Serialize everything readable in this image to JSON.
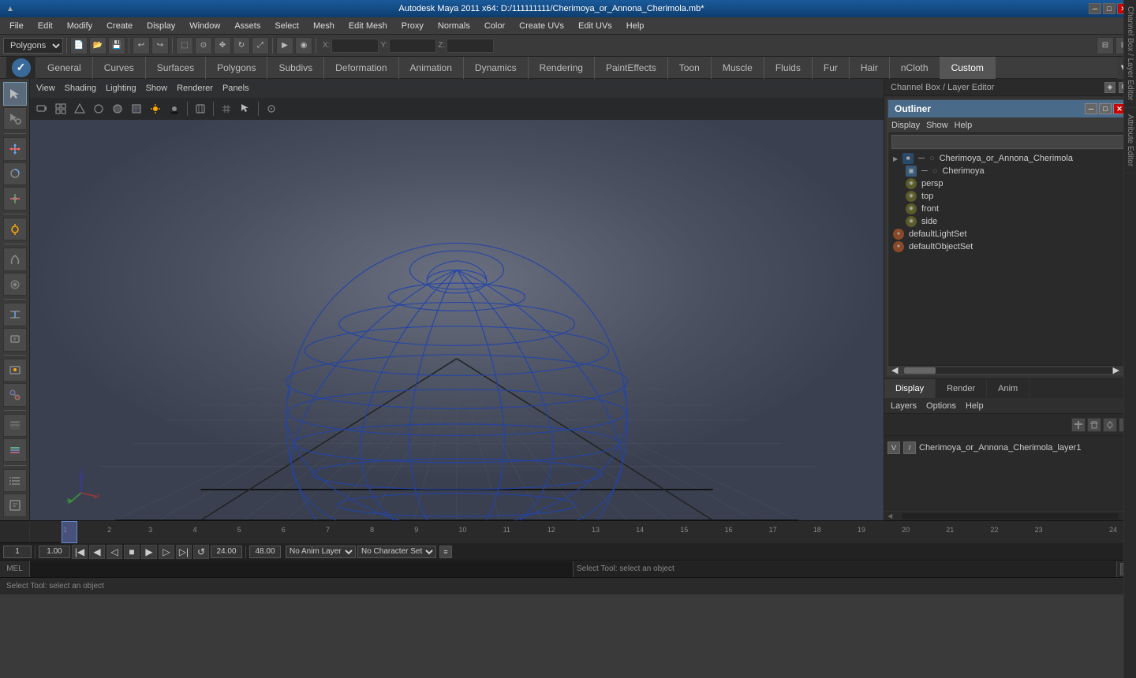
{
  "titleBar": {
    "title": "Autodesk Maya 2011 x64: D:/111111111/Cherimoya_or_Annona_Cherimola.mb*",
    "minBtn": "─",
    "maxBtn": "□",
    "closeBtn": "✕"
  },
  "menuBar": {
    "items": [
      "File",
      "Edit",
      "Modify",
      "Create",
      "Display",
      "Window",
      "Assets",
      "Select",
      "Mesh",
      "Edit Mesh",
      "Proxy",
      "Normals",
      "Color",
      "Create UVs",
      "Edit UVs",
      "Help"
    ]
  },
  "moduleTabs": {
    "items": [
      "General",
      "Curves",
      "Surfaces",
      "Polygons",
      "Subdivs",
      "Deformation",
      "Animation",
      "Dynamics",
      "Rendering",
      "PaintEffects",
      "Toon",
      "Muscle",
      "Fluids",
      "Fur",
      "Hair",
      "nCloth",
      "Custom"
    ],
    "active": "Custom"
  },
  "viewport": {
    "menus": [
      "View",
      "Shading",
      "Lighting",
      "Show",
      "Renderer",
      "Panels"
    ]
  },
  "outliner": {
    "title": "Outliner",
    "menuItems": [
      "Display",
      "Show",
      "Help"
    ],
    "searchPlaceholder": "",
    "tree": [
      {
        "name": "Cherimoya_or_Annona_Cherimola",
        "indent": 0,
        "expanded": true,
        "type": "group"
      },
      {
        "name": "Cherimoya",
        "indent": 1,
        "type": "mesh"
      },
      {
        "name": "persp",
        "indent": 1,
        "type": "camera"
      },
      {
        "name": "top",
        "indent": 1,
        "type": "camera"
      },
      {
        "name": "front",
        "indent": 1,
        "type": "camera"
      },
      {
        "name": "side",
        "indent": 1,
        "type": "camera"
      },
      {
        "name": "defaultLightSet",
        "indent": 0,
        "type": "set"
      },
      {
        "name": "defaultObjectSet",
        "indent": 0,
        "type": "set"
      }
    ]
  },
  "channelBox": {
    "header": "Channel Box / Layer Editor",
    "tabs": [
      "Display",
      "Render",
      "Anim"
    ],
    "activeTab": "Display",
    "subMenuItems": [
      "Layers",
      "Options",
      "Help"
    ],
    "layer": {
      "v": "V",
      "name": "Cherimoya_or_Annona_Cherimola_layer1"
    }
  },
  "timeline": {
    "start": 1,
    "end": 24,
    "currentFrame": 1,
    "numbers": [
      1,
      2,
      3,
      4,
      5,
      6,
      7,
      8,
      9,
      10,
      11,
      12,
      13,
      14,
      15,
      16,
      17,
      18,
      19,
      20,
      21,
      22,
      23,
      24
    ]
  },
  "playback": {
    "currentFrame": "1.00",
    "rangeStart": "1.00",
    "rangeEnd": "24.00",
    "totalFrames": "48.00",
    "animLayer": "No Anim Layer",
    "characterSet": "No Character Set"
  },
  "commandLine": {
    "label": "MEL",
    "inputPlaceholder": "",
    "outputText": "Select Tool: select an object"
  },
  "helpLine": {
    "text": "Select Tool: select an object"
  },
  "displayShowHelp": {
    "text": "Display Show Help"
  }
}
